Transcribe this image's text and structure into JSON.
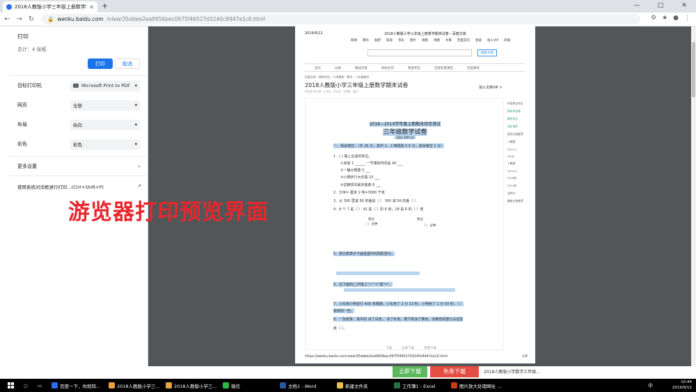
{
  "browser": {
    "tab_title": "2018人教版小学三年级上册数学期末试卷",
    "url_domain": "wenku.baidu.com",
    "url_path": "/view/35ddee2ea9956bec0975f46527d3240c8447a1c0.html"
  },
  "print_panel": {
    "title": "打印",
    "total": "总计：4 张纸",
    "print_button": "打印",
    "cancel_button": "取消",
    "destination_label": "目标打印机",
    "destination_value": "Microsoft Print to PDF",
    "pages_label": "网页",
    "pages_value": "全部",
    "layout_label": "布局",
    "layout_value": "纵向",
    "color_label": "彩色",
    "color_value": "彩色",
    "more_settings": "更多设置",
    "system_dialog": "使用系统对话框进行打印...(Ctrl+Shift+P)"
  },
  "overlay_caption": "游览器打印预览界面",
  "preview": {
    "date": "2019/9/12",
    "page_header": "2018人教版小学三年级上册数学期末试卷 - 百度文库",
    "nav_items": [
      "新闻",
      "网页",
      "贴吧",
      "知道",
      "音乐",
      "图片",
      "视频",
      "地图",
      "文库",
      "百度首页",
      "登录",
      "加入VIP",
      "商城"
    ],
    "search_button": "搜索文档",
    "categories": [
      "首页",
      "分类",
      "精品内容",
      "机构合作",
      "频道专区",
      "百度智慧课堂",
      "百度教育"
    ],
    "doc_title": "2018人教版小学三年级上册数学期末试卷",
    "vip_text": "加入文库VIP >",
    "sheet_title_1": "2018—2019学年度上期期末综合测试",
    "sheet_title_2": "三年级数学试卷",
    "sheet_note": "（总分 100 分）",
    "q_fill": "一、我会填空：（共 26 分，其中 1，2 两题各 0.5 分，其余每空 1 分）",
    "q_lines": [
      "1．(     )    填上合适的单位。",
      "①身高 1 ______    一节课的时间是 40 ___",
      "②一桶大概重 5 ___",
      "③小明步行大约需 15 ___",
      "④这辆货车最多能装 8 ___",
      "2．分米=      厘米              1 吨=3000 千克",
      "3．从 300 里减 56 的差是（  ）      300 减 56 的差（    ）",
      "4．8 个 7 是（    ）        42 是（    ）的 6 倍，18 是 6 的（    ）倍"
    ],
    "clock_label_1": "经过",
    "clock_label_2": "经过",
    "clock_answer_1": "（    ）分钟",
    "clock_answer_2": "（    ）分钟",
    "q_shade": "5．用分数表示下面各图中的阴影部分。",
    "q_compare": "6．在下面的◯中填上\">\"\"<\"或\"=\"。",
    "q_lines_2": [
      "7．小东和小明进行 400 米赛跑，小东用了 2 分 13 秒，小明用了 1 分 59 秒，（    ）",
      "跑得快一些。",
      "8．一张纸条，其中的   涂了白色，   涂了红色，剩下的涂了黄色，涂黄色的部分占这张",
      "纸（     ）。"
    ],
    "sidebar_items": [
      "中国考试专区",
      "期末测试卷",
      "教学设计",
      "同步课件",
      "相关文档推荐",
      "人教版",
      "2017-2",
      "2018",
      "人教版",
      "2014-2",
      "2018年",
      "2014年",
      "北师大",
      "最新文档推荐"
    ],
    "bottom_bar": [
      "下载",
      "立即下载",
      "免费下载"
    ],
    "footer_url": "https://wenku.baidu.com/view/35ddee2ea9956bec0975f46527d3240c8447a1c0.html",
    "footer_page": "1/4"
  },
  "behind_strip": {
    "green_button": "立即下载",
    "red_button": "免券下载",
    "text": "2018人教版小学数学三年级..."
  },
  "taskbar": {
    "items": [
      {
        "label": "百度一下，你就知...",
        "color": "#2b6def"
      },
      {
        "label": "2018人教版小学三...",
        "color": "#e8a33a"
      },
      {
        "label": "2018人教版小学三...",
        "color": "#e8a33a"
      },
      {
        "label": "微信",
        "color": "#2fb545"
      },
      {
        "label": "文档1 - Word",
        "color": "#2b579a"
      },
      {
        "label": "新建文件夹",
        "color": "#e8c24a"
      },
      {
        "label": "工作簿1 - Excel",
        "color": "#217346"
      },
      {
        "label": "图片放大处理网址 ...",
        "color": "#c43e1c"
      }
    ],
    "time": "10:44",
    "date": "2019/9/12",
    "lang": "中"
  }
}
